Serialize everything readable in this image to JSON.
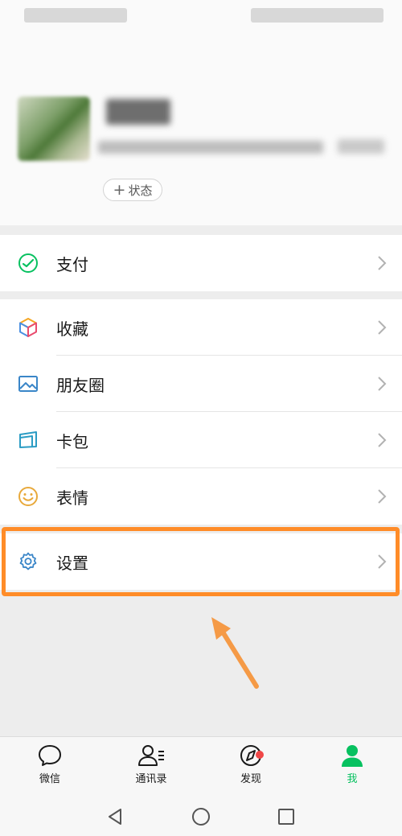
{
  "profile": {
    "status_label": "状态",
    "status_plus": "+"
  },
  "pay_group": [
    {
      "label": "支付",
      "icon": "wallet-icon"
    }
  ],
  "main_group": [
    {
      "label": "收藏",
      "icon": "cube-icon"
    },
    {
      "label": "朋友圈",
      "icon": "image-icon"
    },
    {
      "label": "卡包",
      "icon": "card-icon"
    },
    {
      "label": "表情",
      "icon": "smiley-icon"
    }
  ],
  "settings_group": [
    {
      "label": "设置",
      "icon": "gear-icon"
    }
  ],
  "tabbar": {
    "tabs": [
      {
        "label": "微信",
        "icon": "chat-bubble-icon"
      },
      {
        "label": "通讯录",
        "icon": "contacts-icon"
      },
      {
        "label": "发现",
        "icon": "compass-icon"
      },
      {
        "label": "我",
        "icon": "person-icon"
      }
    ],
    "active": "我"
  },
  "colors": {
    "accent_green": "#07c160",
    "highlight_orange": "#ff8c28",
    "badge_red": "#f04747"
  }
}
